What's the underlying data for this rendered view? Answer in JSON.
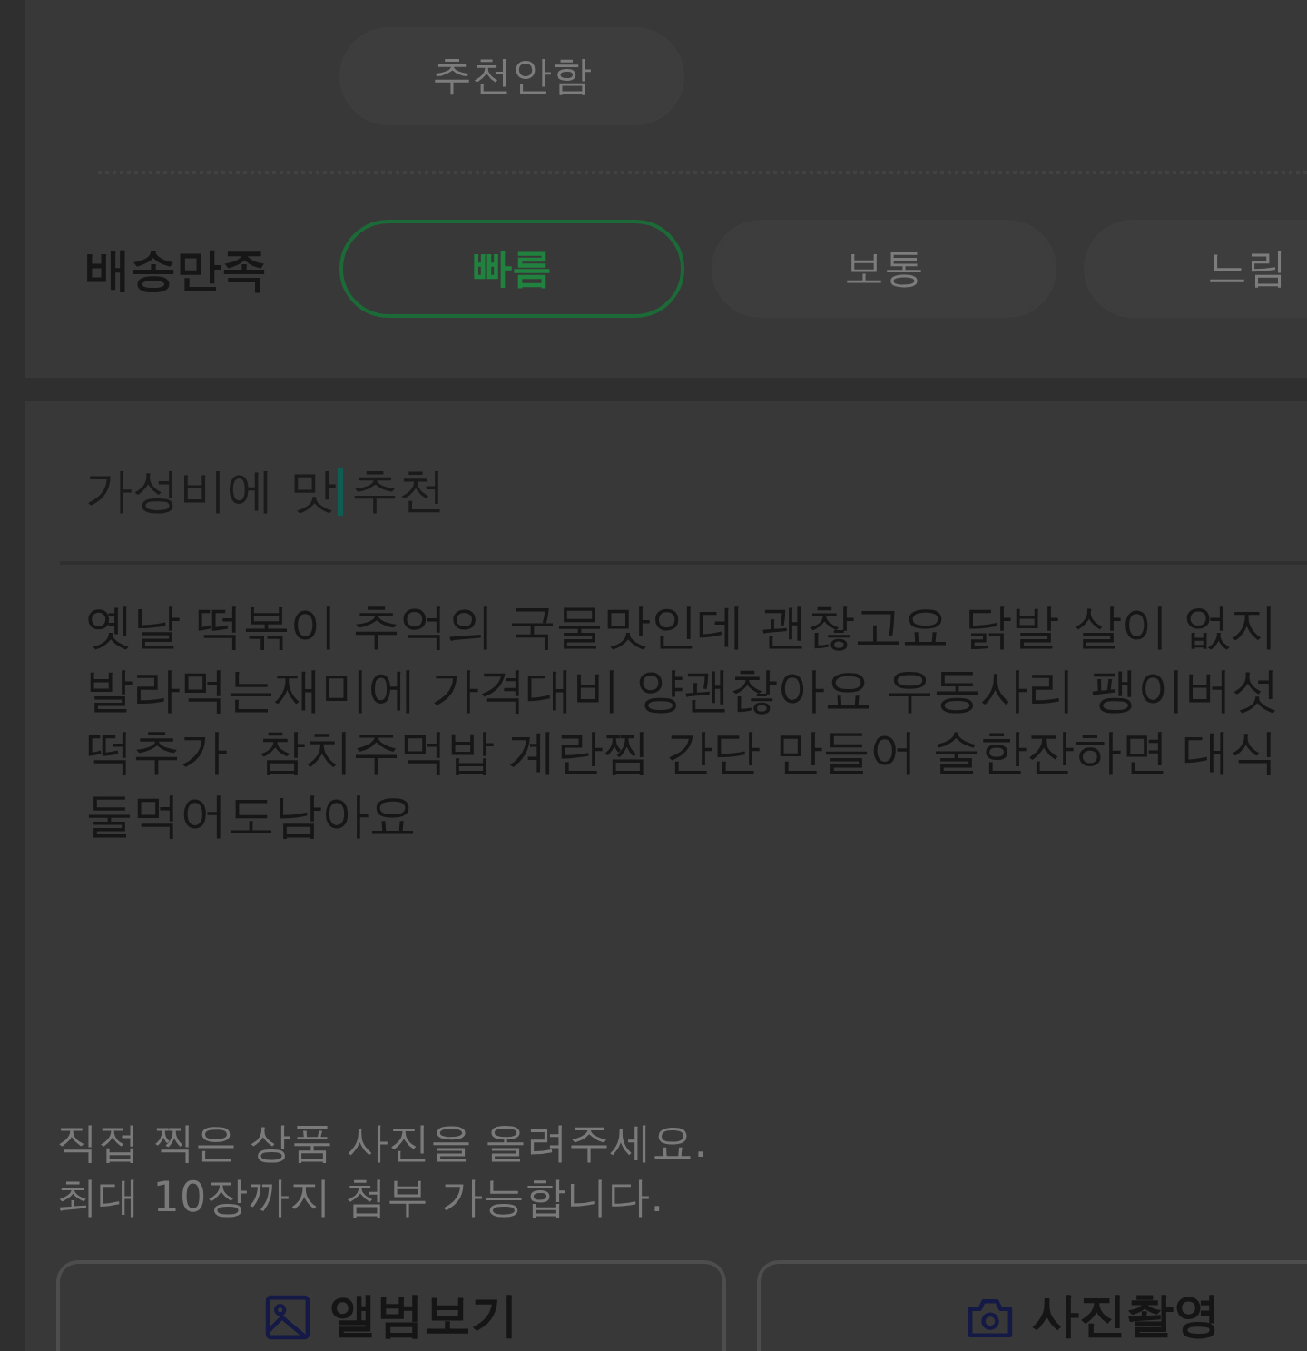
{
  "recommend_options": [
    {
      "label": "추천안함",
      "selected": false
    }
  ],
  "delivery_rating": {
    "label": "배송만족",
    "options": [
      {
        "label": "빠름",
        "selected": true
      },
      {
        "label": "보통",
        "selected": false
      },
      {
        "label": "느림",
        "selected": false
      }
    ]
  },
  "review_title": {
    "value_before_cursor": "가성비에 맛",
    "value_after_cursor": " 추천"
  },
  "review_body": {
    "lines": [
      "옛날 떡볶이 추억의 국물맛인데 괜찮고요 닭발 살이 없지",
      "발라먹는재미에 가격대비 양괜찮아요 우동사리 팽이버섯",
      "떡추가  참치주먹밥 계란찜 간단 만들어 술한잔하면 대식",
      "둘먹어도남아요"
    ]
  },
  "photo_hint": "직접 찍은 상품 사진을 올려주세요.\n최대 10장까지 첨부 가능합니다.",
  "photo_buttons": [
    {
      "kind": "album",
      "label": "앨범보기"
    },
    {
      "kind": "camera",
      "label": "사진촬영"
    }
  ]
}
